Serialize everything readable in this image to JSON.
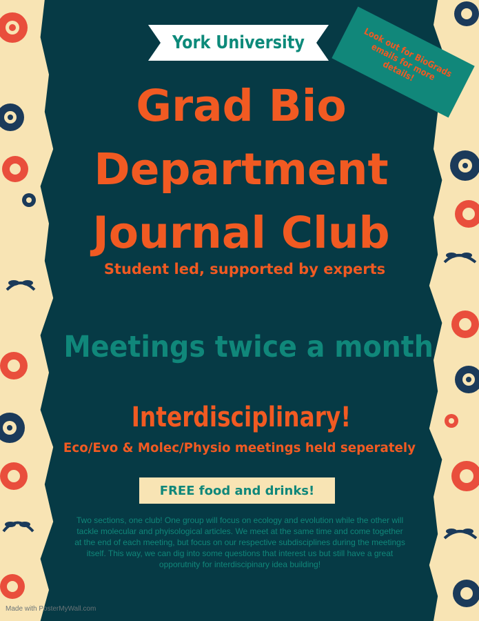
{
  "banner": {
    "text": "York University"
  },
  "sticker": {
    "text": "Look out for BioGrads emails for more details!"
  },
  "title": {
    "line1": "Grad Bio",
    "line2": "Department",
    "line3": "Journal Club"
  },
  "subtitle": "Student led, supported by experts",
  "meetings": "Meetings twice a month",
  "interdisciplinary": {
    "heading": "Interdisciplinary!",
    "note": "Eco/Evo & Molec/Physio meetings held seperately"
  },
  "food": "FREE food and drinks!",
  "description": "Two sections, one club! One group will focus on ecology and evolution while the other will tackle molecular and phyisological articles. We meet at the same time and come together at the end of each meeting, but focus on our respective subdisciplines during the meetings itself. This way, we can dig into some questions that interest us but still have a great opporutnity for interdiscipinary idea building!",
  "watermark": "Made with PosterMyWall.com",
  "colors": {
    "background_panel": "#063a45",
    "accent_orange": "#f15a22",
    "accent_teal": "#10877a",
    "cream": "#f8e4b4"
  },
  "icons": [
    "flower-icon",
    "leaf-sprig-icon",
    "circle-dot-icon"
  ]
}
